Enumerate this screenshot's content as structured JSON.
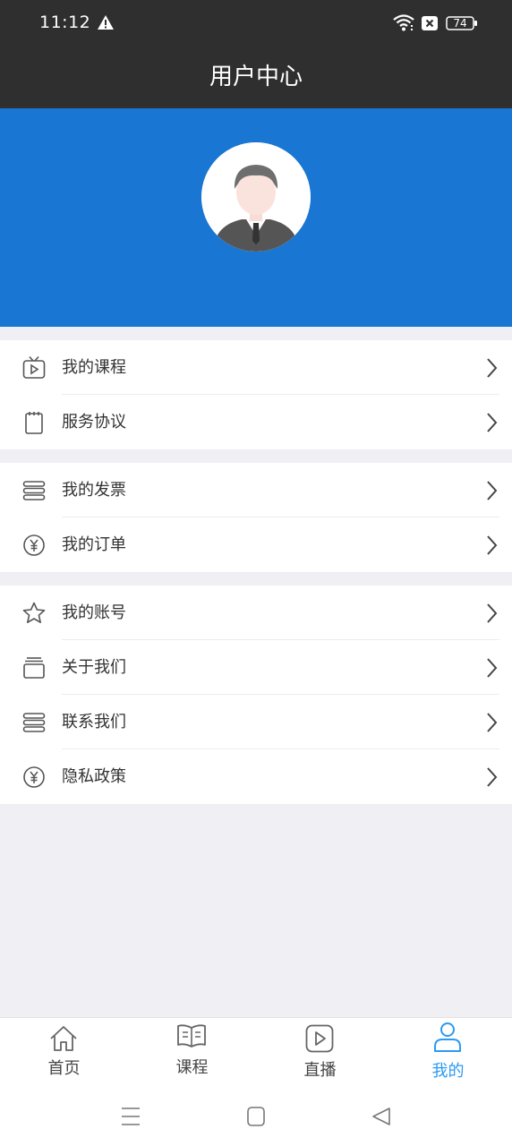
{
  "status_bar": {
    "time": "11:12",
    "battery": "74"
  },
  "header": {
    "title": "用户中心"
  },
  "menu_groups": [
    {
      "items": [
        {
          "label": "我的课程",
          "icon": "tv-play-icon"
        },
        {
          "label": "服务协议",
          "icon": "notepad-icon"
        }
      ]
    },
    {
      "items": [
        {
          "label": "我的发票",
          "icon": "stack-icon"
        },
        {
          "label": "我的订单",
          "icon": "yuan-coin-icon"
        }
      ]
    },
    {
      "items": [
        {
          "label": "我的账号",
          "icon": "star-icon"
        },
        {
          "label": "关于我们",
          "icon": "cards-icon"
        },
        {
          "label": "联系我们",
          "icon": "stack-icon"
        },
        {
          "label": "隐私政策",
          "icon": "yuan-coin-icon"
        }
      ]
    }
  ],
  "tab_bar": {
    "tabs": [
      {
        "label": "首页",
        "icon": "home-icon"
      },
      {
        "label": "课程",
        "icon": "book-icon"
      },
      {
        "label": "直播",
        "icon": "play-icon"
      },
      {
        "label": "我的",
        "icon": "user-icon",
        "active": true
      }
    ]
  },
  "colors": {
    "header_blue": "#1976d2",
    "active_tab": "#2b9af3",
    "status_bar": "#2f2f2f"
  }
}
